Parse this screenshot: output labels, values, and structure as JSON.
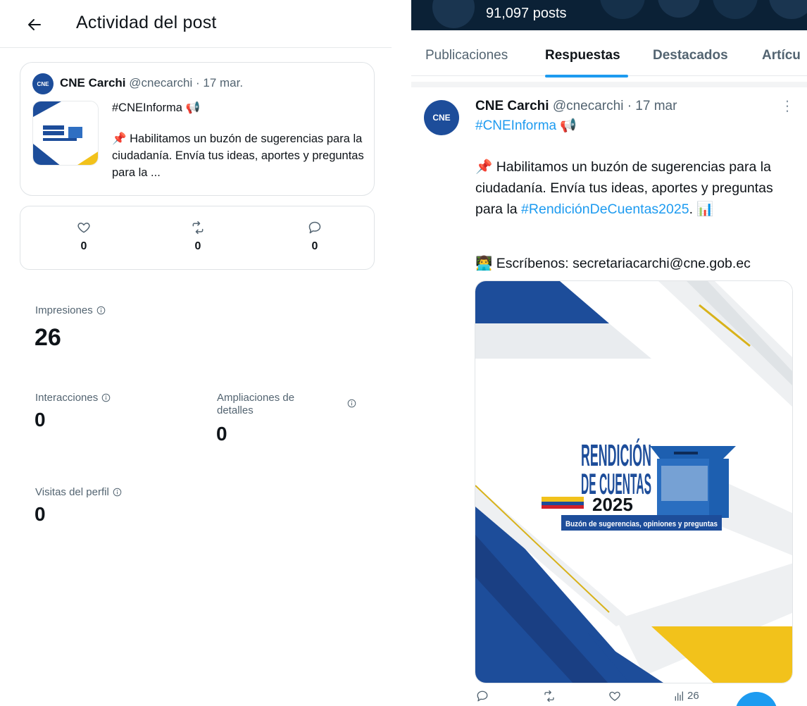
{
  "left": {
    "header_title": "Actividad del post",
    "post": {
      "author_name": "CNE Carchi",
      "author_meta": "@cnecarchi · 17 mar.",
      "line1": "#CNEInforma 📢",
      "line2": "📌 Habilitamos un buzón de sugerencias para la ciudadanía. Envía tus ideas, aportes y preguntas para la ..."
    },
    "metrics": {
      "likes": "0",
      "reposts": "0",
      "replies": "0"
    },
    "stats": {
      "impressions_label": "Impresiones",
      "impressions_value": "26",
      "interactions_label": "Interacciones",
      "interactions_value": "0",
      "expansions_label": "Ampliaciones de detalles",
      "expansions_value": "0",
      "profile_visits_label": "Visitas del perfil",
      "profile_visits_value": "0"
    }
  },
  "right": {
    "banner_text": "91,097 posts",
    "tabs": [
      "Publicaciones",
      "Respuestas",
      "Destacados",
      "Artícu"
    ],
    "active_tab": "Respuestas",
    "post": {
      "author_name": "CNE Carchi",
      "author_meta": "@cnecarchi · 17 mar",
      "hashtag": "#CNEInforma 📢",
      "body_text": "📌 Habilitamos un buzón de sugerencias para la ciudadanía. Envía tus ideas, aportes y preguntas para la ",
      "body_link": "#RendiciónDeCuentas2025",
      "body_end": ". 📊",
      "email_line": "👨‍💻 Escríbenos: secretariacarchi@cne.gob.ec",
      "views": "26"
    },
    "image_text": {
      "line1": "RENDICIÓN",
      "line2": "DE CUENTAS",
      "year": "2025",
      "caption": "Buzón de sugerencias, opiniones y preguntas"
    }
  },
  "avatar_text": "CNE",
  "colors": {
    "accent": "#1d9bf0",
    "text": "#0f1419",
    "muted": "#536471",
    "brand_blue": "#1d4d9a",
    "brand_yellow": "#f2c21b"
  }
}
